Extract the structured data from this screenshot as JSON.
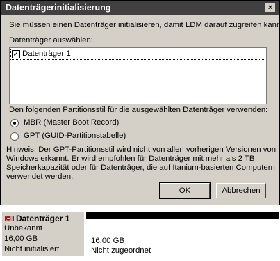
{
  "dialog": {
    "title": "Datenträgerinitialisierung",
    "close_glyph": "×",
    "intro": "Sie müssen einen Datenträger initialisieren, damit LDM darauf zugreifen kann.",
    "select_label": "Datenträger auswählen:",
    "disks": [
      {
        "label": "Datenträger 1",
        "checked": true
      }
    ],
    "check_glyph": "✓",
    "partition_style_label": "Den folgenden Partitionsstil für die ausgewählten Datenträger verwenden:",
    "options": [
      {
        "label": "MBR (Master Boot Record)",
        "selected": true
      },
      {
        "label": "GPT (GUID-Partitionstabelle)",
        "selected": false
      }
    ],
    "hint_lines": [
      "Hinweis: Der GPT-Partitionsstil wird nicht von allen vorherigen Versionen von",
      "Windows erkannt. Er wird empfohlen für Datenträger mit mehr als 2 TB",
      "Speicherkapazität oder für Datenträger, die auf Itanium-basierten Computern",
      "verwendet werden."
    ],
    "ok_label": "OK",
    "cancel_label": "Abbrechen"
  },
  "disk_map": {
    "name": "Datenträger 1",
    "type": "Unbekannt",
    "size": "16,00 GB",
    "status": "Nicht initialisiert",
    "partition_size": "16,00 GB",
    "partition_status": "Nicht zugeordnet"
  },
  "colors": {
    "dialog_bg": "#d4d0c8",
    "titlebar_bg": "#404040",
    "unallocated_bar": "#000000"
  }
}
